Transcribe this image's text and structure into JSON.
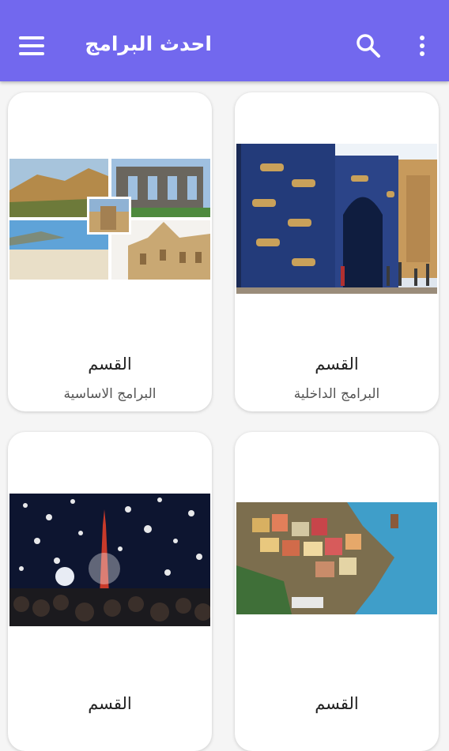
{
  "appbar": {
    "title": "احدث البرامج",
    "menu_icon": "hamburger-menu-icon",
    "search_icon": "search-icon",
    "more_icon": "overflow-menu-icon",
    "color": "#7268ee"
  },
  "cards": [
    {
      "title": "القسم",
      "subtitle": "البرامج الداخلية",
      "image": "ishtar-gate-photo"
    },
    {
      "title": "القسم",
      "subtitle": "البرامج الاساسية",
      "image": "travel-collage-photo"
    },
    {
      "title": "القسم",
      "subtitle": "",
      "image": "cinque-terre-photo"
    },
    {
      "title": "القسم",
      "subtitle": "",
      "image": "night-festival-photo"
    }
  ]
}
